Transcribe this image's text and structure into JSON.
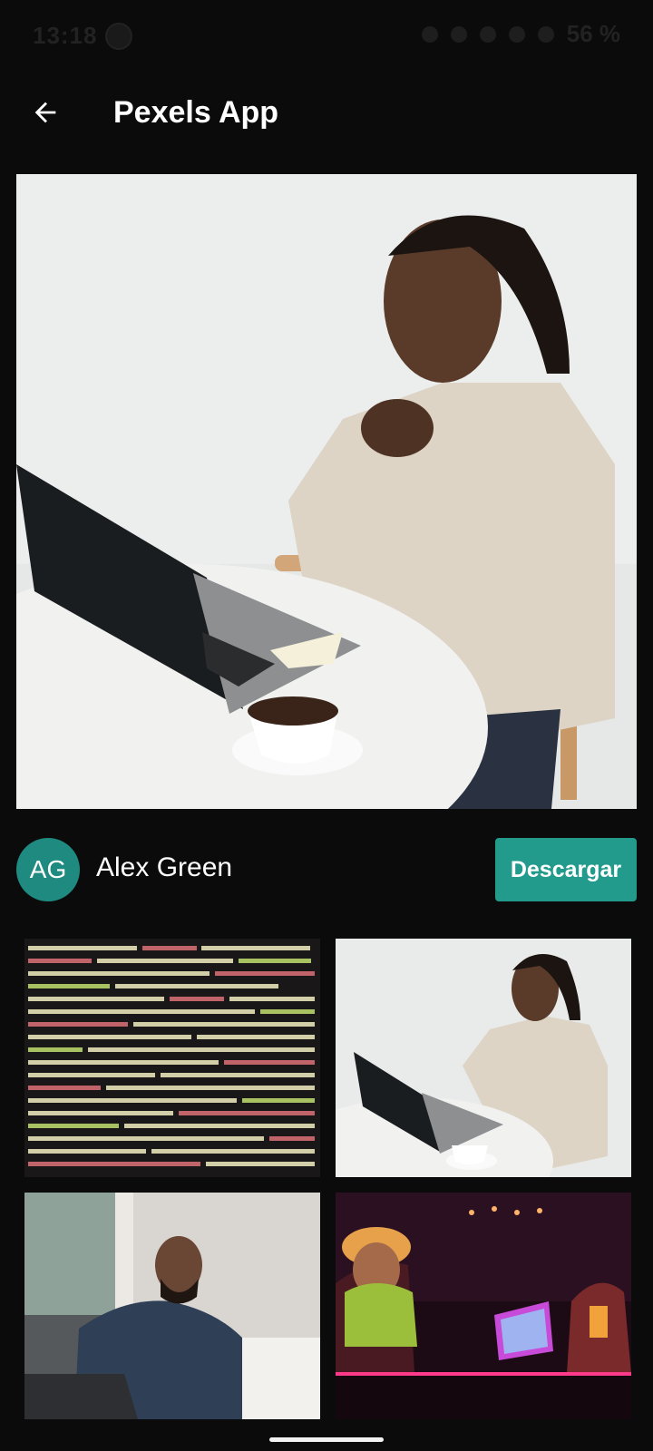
{
  "status_bar": {
    "time": "13:18",
    "battery": "56 %"
  },
  "app_bar": {
    "title": "Pexels App",
    "back_icon": "arrow-left-icon"
  },
  "photo": {
    "author_initials": "AG",
    "author_name": "Alex Green",
    "download_label": "Descargar"
  },
  "colors": {
    "background": "#0b0b0b",
    "accent": "#229a8c",
    "avatar": "#1e8a80"
  },
  "grid": {
    "tiles": [
      {
        "subject": "code-screen"
      },
      {
        "subject": "man-with-laptop"
      },
      {
        "subject": "man-typing-on-laptop"
      },
      {
        "subject": "people-in-neon-bar"
      }
    ]
  }
}
